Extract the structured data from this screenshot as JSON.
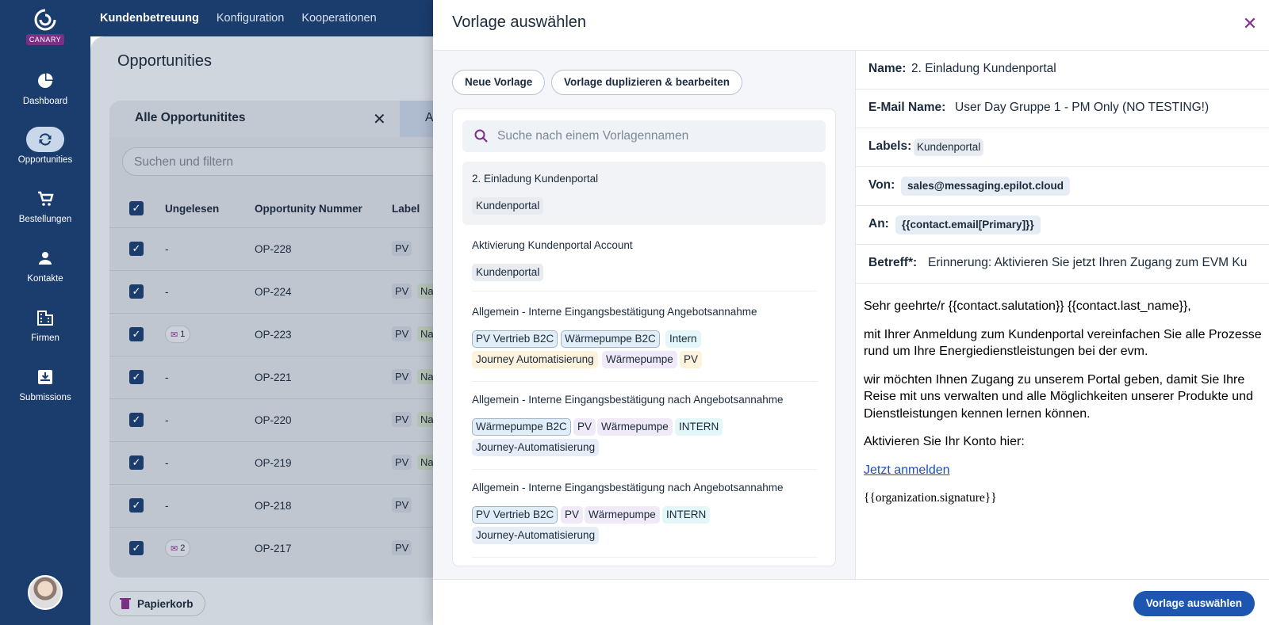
{
  "app": {
    "brand": "CANARY"
  },
  "sidebar": {
    "items": [
      {
        "label": "Dashboard",
        "icon": "pie-chart-icon"
      },
      {
        "label": "Opportunities",
        "icon": "sync-icon",
        "active": true
      },
      {
        "label": "Bestellungen",
        "icon": "cart-icon"
      },
      {
        "label": "Kontakte",
        "icon": "person-icon"
      },
      {
        "label": "Firmen",
        "icon": "building-icon"
      },
      {
        "label": "Submissions",
        "icon": "inbox-icon"
      }
    ]
  },
  "topnav": {
    "items": [
      "Kundenbetreuung",
      "Konfiguration",
      "Kooperationen"
    ]
  },
  "background": {
    "page_title": "Opportunities",
    "tab_label": "Alle Opportunitites",
    "tab2_partial": "A",
    "search_placeholder": "Suchen und filtern",
    "columns": [
      "Ungelesen",
      "Opportunity Nummer",
      "Label"
    ],
    "rows": [
      {
        "unread": "-",
        "number": "OP-228",
        "labels": [
          "PV"
        ]
      },
      {
        "unread": "-",
        "number": "OP-224",
        "labels": [
          "PV",
          "Na"
        ]
      },
      {
        "unread": "1",
        "number": "OP-223",
        "labels": [
          "PV",
          "Na"
        ]
      },
      {
        "unread": "-",
        "number": "OP-221",
        "labels": [
          "PV",
          "Na"
        ]
      },
      {
        "unread": "-",
        "number": "OP-220",
        "labels": [
          "PV",
          "Na"
        ]
      },
      {
        "unread": "-",
        "number": "OP-219",
        "labels": [
          "PV",
          "Na"
        ]
      },
      {
        "unread": "-",
        "number": "OP-218",
        "labels": [
          "PV"
        ]
      },
      {
        "unread": "2",
        "number": "OP-217",
        "labels": [
          "PV"
        ]
      }
    ],
    "trash_label": "Papierkorb"
  },
  "modal": {
    "title": "Vorlage auswählen",
    "buttons": {
      "new": "Neue Vorlage",
      "duplicate": "Vorlage duplizieren & bearbeiten",
      "select": "Vorlage auswählen"
    },
    "search_placeholder": "Suche nach einem Vorlagennamen",
    "templates": [
      {
        "name": "2. Einladung Kundenportal",
        "tags": [
          "Kundenportal"
        ]
      },
      {
        "name": "Aktivierung Kundenportal Account",
        "tags": [
          "Kundenportal"
        ]
      },
      {
        "name": "Allgemein - Interne Eingangsbestätigung Angebotsannahme",
        "tags": [
          "PV Vertrieb B2C",
          "Wärmepumpe B2C",
          "Intern",
          "Journey Automatisierung",
          "Wärmepumpe",
          "PV"
        ]
      },
      {
        "name": "Allgemein - Interne Eingangsbestätigung nach Angebotsannahme",
        "tags": [
          "Wärmepumpe B2C",
          "PV",
          "Wärmepumpe",
          "INTERN",
          "Journey-Automatisierung"
        ]
      },
      {
        "name": "Allgemein - Interne Eingangsbestätigung nach Angebotsannahme",
        "tags": [
          "PV Vertrieb B2C",
          "PV",
          "Wärmepumpe",
          "INTERN",
          "Journey-Automatisierung"
        ]
      }
    ],
    "preview": {
      "name_label": "Name:",
      "name": "2. Einladung Kundenportal",
      "email_name_label": "E-Mail Name:",
      "email_name": "User Day Gruppe 1 - PM Only (NO TESTING!)",
      "labels_label": "Labels:",
      "labels": [
        "Kundenportal"
      ],
      "from_label": "Von:",
      "from": "sales@messaging.epilot.cloud",
      "to_label": "An:",
      "to": "{{contact.email[Primary]}}",
      "subject_label": "Betreff*:",
      "subject": "Erinnerung: Aktivieren Sie jetzt Ihren Zugang zum EVM Ku",
      "body": {
        "greeting": "Sehr geehrte/r {{contact.salutation}} {{contact.last_name}},",
        "p1": "mit Ihrer Anmeldung zum Kundenportal vereinfachen Sie alle Prozesse rund um Ihre Energiedienstleistungen bei der evm.",
        "p2": "wir möchten Ihnen Zugang zu unserem Portal geben, damit Sie Ihre Reise mit uns verwalten und alle Möglichkeiten unserer Produkte und Dienstleistungen kennen lernen können.",
        "p3": "Aktivieren Sie Ihr Konto hier:",
        "link": "Jetzt anmelden",
        "signature": "{{organization.signature}}"
      }
    }
  },
  "colors": {
    "sidebar": "#1b3d6e",
    "accent": "#7c2f87",
    "primary_button": "#1c56b0"
  }
}
